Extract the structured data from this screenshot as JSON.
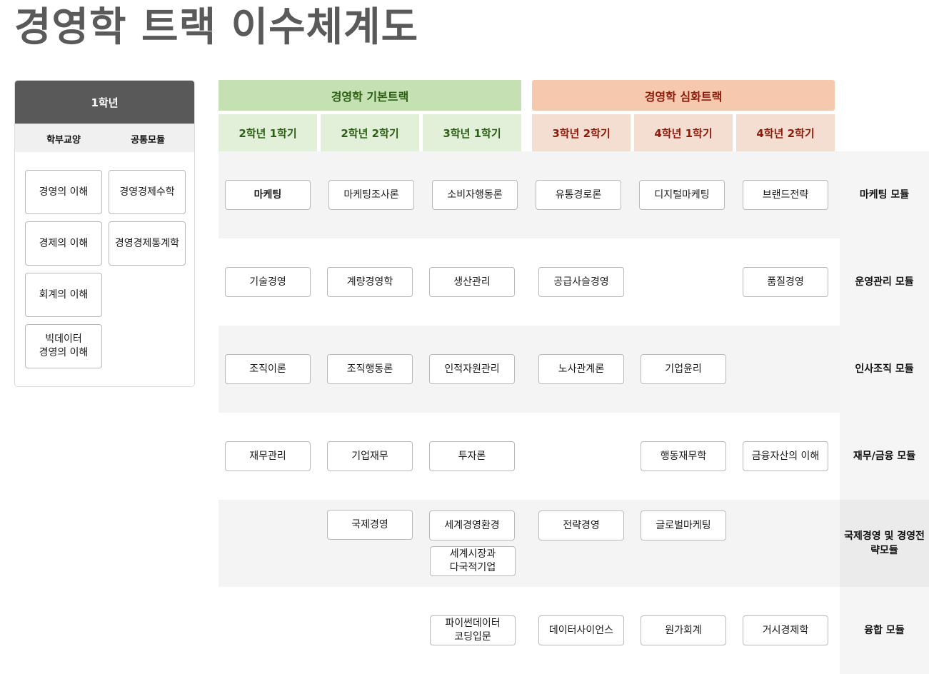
{
  "title": "경영학 트랙 이수체계도",
  "first_year": {
    "header": "1학년",
    "columns": [
      "학부교양",
      "공통모듈"
    ],
    "liberal_arts": [
      "경영의 이해",
      "경제의 이해",
      "회계의 이해",
      "빅데이터\n경영의 이해"
    ],
    "common_module": [
      "경영경제수학",
      "경영경제통계학"
    ]
  },
  "tracks": {
    "basic": "경영학 기본트랙",
    "advanced": "경영학 심화트랙"
  },
  "semesters": [
    "2학년 1학기",
    "2학년 2학기",
    "3학년 1학기",
    "3학년 2학기",
    "4학년 1학기",
    "4학년 2학기"
  ],
  "modules": [
    {
      "label": "마케팅 모듈",
      "courses": [
        "마케팅",
        "마케팅조사론",
        "소비자행동론",
        "유통경로론",
        "디지털마케팅",
        "브랜드전략"
      ]
    },
    {
      "label": "운영관리 모듈",
      "courses": [
        "기술경영",
        "계량경영학",
        "생산관리",
        "공급사슬경영",
        "품질경영"
      ]
    },
    {
      "label": "인사조직 모듈",
      "courses": [
        "조직이론",
        "조직행동론",
        "인적자원관리",
        "노사관계론",
        "기업윤리"
      ]
    },
    {
      "label": "재무/금융 모듈",
      "courses": [
        "재무관리",
        "기업재무",
        "투자론",
        "행동재무학",
        "금융자산의 이해"
      ]
    },
    {
      "label": "국제경영 및\n경영전략모듈",
      "courses": [
        "국제경영",
        "세계경영환경",
        "세계시장과\n다국적기업",
        "전략경영",
        "글로벌마케팅"
      ]
    },
    {
      "label": "융합 모듈",
      "courses": [
        "파이썬데이터\n코딩입문",
        "데이터사이언스",
        "원가회계",
        "거시경제학"
      ]
    }
  ],
  "colors": {
    "basic_track": "#c5e0b2",
    "basic_text": "#2b5f14",
    "advanced_track": "#f6c8ad",
    "advanced_text": "#8c1a0b",
    "first_year_header": "#595959"
  }
}
